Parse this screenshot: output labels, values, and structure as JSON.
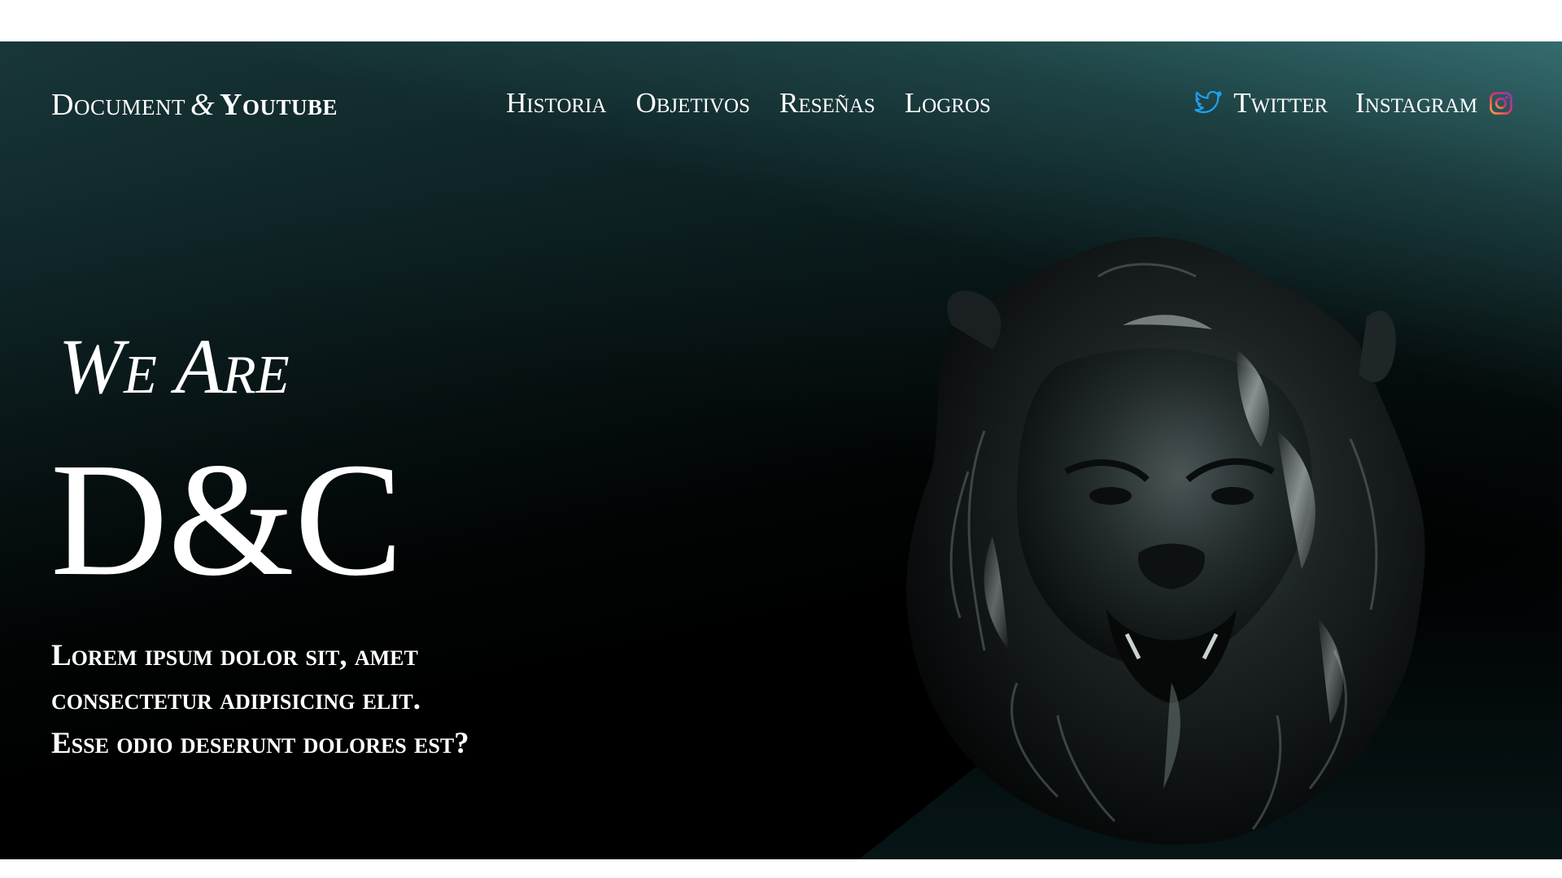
{
  "brand": {
    "part1": "Document",
    "amp": "&",
    "part2": "Youtube"
  },
  "nav": {
    "items": [
      {
        "label": "Historia"
      },
      {
        "label": "Objetivos"
      },
      {
        "label": "Reseñas"
      },
      {
        "label": "Logros"
      }
    ]
  },
  "social": {
    "twitter": {
      "label": "Twitter",
      "icon": "twitter-icon",
      "color": "#1da1f2"
    },
    "instagram": {
      "label": "Instagram",
      "icon": "instagram-icon",
      "color": "#c13584"
    }
  },
  "hero": {
    "kicker": "We Are",
    "title": "D&C",
    "lead_lines": [
      "Lorem ipsum dolor sit, amet",
      "consectetur adipisicing elit.",
      "Esse odio deserunt dolores est?"
    ],
    "image": "lion-head-sculpture"
  },
  "colors": {
    "teal": "#377072",
    "background": "#000000",
    "text": "#ffffff"
  }
}
